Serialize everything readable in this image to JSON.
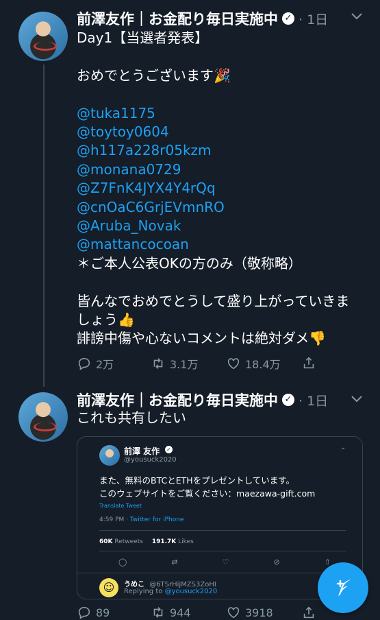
{
  "tweet1": {
    "name": "前澤友作｜お金配り毎日実施中",
    "time": "· 1日",
    "line1": "Day1【当選者発表】",
    "line2": "おめでとうございます🎉",
    "mentions": [
      "@tuka1175",
      "@toytoy0604",
      "@h117a228r05kzm",
      "@monana0729",
      "@Z7FnK4JYX4Y4rQq",
      "@cnOaC6GrjEVmnRO",
      "@Aruba_Novak",
      "@mattancocoan"
    ],
    "line3": "＊ご本人公表OKの方のみ（敬称略）",
    "line4": "皆んなでおめでとうして盛り上がっていきま",
    "line5": "しょう👍",
    "line6": "誹謗中傷や心ないコメントは絶対ダメ👎",
    "replies": "2万",
    "retweets": "3.1万",
    "likes": "18.4万"
  },
  "tweet2": {
    "name": "前澤友作｜お金配り毎日実施中",
    "time": "· 1日",
    "text": "これも共有したい",
    "replies": "89",
    "retweets": "944",
    "likes": "3918"
  },
  "embed": {
    "name": "前澤 友作",
    "handle": "@yousuck2020",
    "line1": "また、無料のBTCとETHをプレゼントしています。",
    "line2": "このウェブサイトをご覧ください：maezawa-gift.com",
    "translate": "Translate Tweet",
    "time": "4:59 PM · ",
    "client": "Twitter for iPhone",
    "rt_count": "60K",
    "rt_label": "Retweets",
    "like_count": "191.7K",
    "like_label": "Likes",
    "reply_name": "うめこ",
    "reply_handle": "@6TSrHijMZS3ZoHI",
    "replying_to": "Replying to ",
    "replying_handle": "@yousuck2020"
  },
  "colors": {
    "bg": "#151d28",
    "accent": "#1da1f2",
    "muted": "#8899a6",
    "border": "#38444d"
  }
}
